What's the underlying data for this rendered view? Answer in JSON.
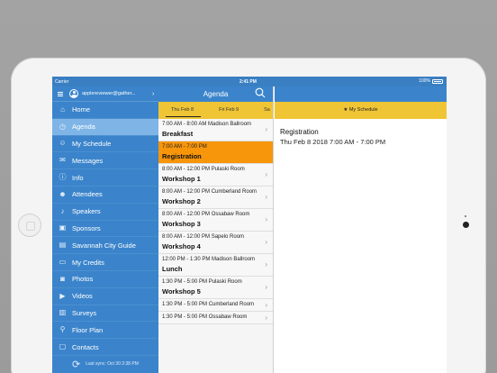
{
  "status": {
    "carrier": "Carrier",
    "time": "2:41 PM",
    "battery": "100%"
  },
  "sidebar": {
    "account": "applereviewer@gather...",
    "items": [
      {
        "label": "Home",
        "icon": "home-icon",
        "glyph": "⌂"
      },
      {
        "label": "Agenda",
        "icon": "agenda-icon",
        "glyph": "◷",
        "active": true
      },
      {
        "label": "My Schedule",
        "icon": "schedule-icon",
        "glyph": "☺"
      },
      {
        "label": "Messages",
        "icon": "mail-icon",
        "glyph": "✉"
      },
      {
        "label": "Info",
        "icon": "info-icon",
        "glyph": "ⓘ"
      },
      {
        "label": "Attendees",
        "icon": "people-icon",
        "glyph": "☻"
      },
      {
        "label": "Speakers",
        "icon": "microphone-icon",
        "glyph": "♪"
      },
      {
        "label": "Sponsors",
        "icon": "sponsors-icon",
        "glyph": "▣"
      },
      {
        "label": "Savannah City Guide",
        "icon": "city-guide-icon",
        "glyph": "▤"
      },
      {
        "label": "My Credits",
        "icon": "credits-icon",
        "glyph": "▭"
      },
      {
        "label": "Photos",
        "icon": "camera-icon",
        "glyph": "◙"
      },
      {
        "label": "Videos",
        "icon": "video-icon",
        "glyph": "▶"
      },
      {
        "label": "Surveys",
        "icon": "surveys-icon",
        "glyph": "▥"
      },
      {
        "label": "Floor Plan",
        "icon": "map-pin-icon",
        "glyph": "⚲"
      },
      {
        "label": "Contacts",
        "icon": "contacts-icon",
        "glyph": "▢"
      }
    ],
    "last_sync": "Last sync: Oct 30 2:38 PM"
  },
  "agenda": {
    "title": "Agenda",
    "tabs": [
      "Thu Feb 8",
      "Fri Feb 9",
      "Sa"
    ],
    "sessions": [
      {
        "time": "7:00 AM - 8:00 AM Madison Ballroom",
        "title": "Breakfast"
      },
      {
        "time": "7:00 AM - 7:00 PM",
        "title": "Registration",
        "highlighted": true
      },
      {
        "time": "8:00 AM - 12:00 PM Pulaski Room",
        "title": "Workshop 1"
      },
      {
        "time": "8:00 AM - 12:00 PM Cumberland Room",
        "title": "Workshop 2"
      },
      {
        "time": "8:00 AM - 12:00 PM Ossabaw Room",
        "title": "Workshop 3"
      },
      {
        "time": "8:00 AM - 12:00 PM Sapelo Room",
        "title": "Workshop 4"
      },
      {
        "time": "12:00 PM - 1:30 PM Madison Ballroom",
        "title": "Lunch"
      },
      {
        "time": "1:30 PM - 5:00 PM Pulaski Room",
        "title": "Workshop 5"
      },
      {
        "time": "1:30 PM - 5:00 PM Cumberland Room",
        "title": ""
      },
      {
        "time": "1:30 PM - 5:00 PM Ossabaw Room",
        "title": ""
      }
    ]
  },
  "detail": {
    "my_schedule": "★ My Schedule",
    "title": "Registration",
    "date": "Thu Feb 8 2018 7:00 AM - 7:00 PM"
  },
  "colors": {
    "primary": "#3b84cb",
    "accent": "#f0c535",
    "highlight": "#f7950b"
  }
}
